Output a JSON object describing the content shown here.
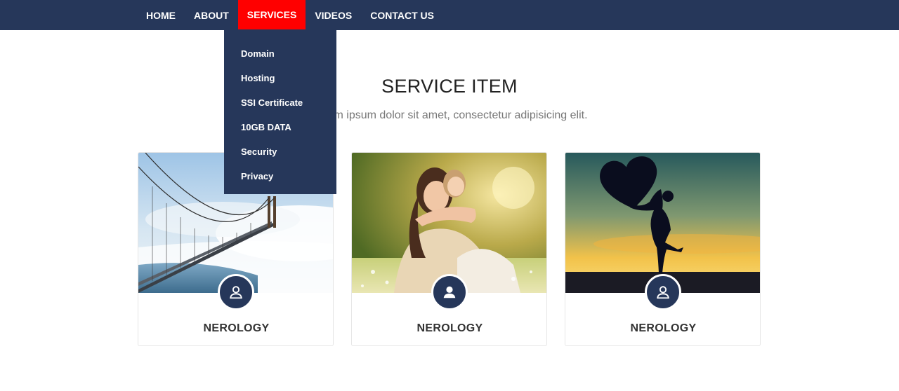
{
  "nav": {
    "items": [
      {
        "label": "HOME"
      },
      {
        "label": "ABOUT"
      },
      {
        "label": "SERVICES",
        "active": true
      },
      {
        "label": "VIDEOS"
      },
      {
        "label": "CONTACT US"
      }
    ],
    "dropdown": [
      "Domain",
      "Hosting",
      "SSI Certificate",
      "10GB DATA",
      "Security",
      "Privacy"
    ]
  },
  "section": {
    "title": "SERVICE ITEM",
    "subtitle": "Lorem ipsum dolor sit amet, consectetur adipisicing elit."
  },
  "cards": [
    {
      "title": "NEROLOGY",
      "image": "bridge-in-fog-photo",
      "icon": "user-outline-icon"
    },
    {
      "title": "NEROLOGY",
      "image": "mother-and-daughter-photo",
      "icon": "user-solid-icon"
    },
    {
      "title": "NEROLOGY",
      "image": "heart-silhouette-sunset-photo",
      "icon": "user-outline-icon"
    }
  ],
  "colors": {
    "navbar": "#26375a",
    "active_nav": "#ff0000",
    "badge": "#26375a"
  }
}
